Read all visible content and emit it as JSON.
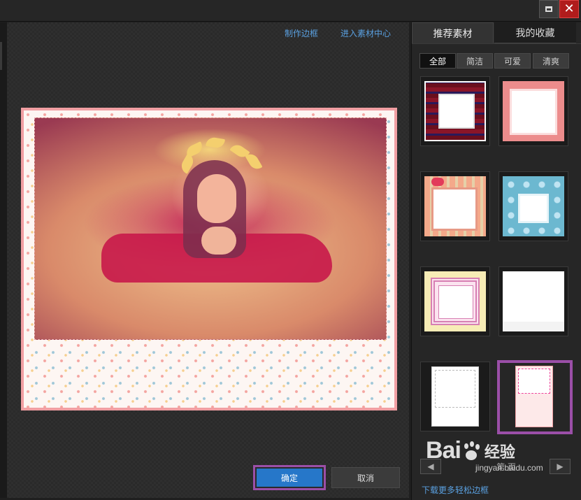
{
  "window": {
    "maximize_icon": "maximize-icon",
    "close_glyph": "✕"
  },
  "editor": {
    "link_make_border": "制作边框",
    "link_material_center": "进入素材中心",
    "ok_label": "确定",
    "cancel_label": "取消"
  },
  "sidebar": {
    "tabs": [
      {
        "label": "推荐素材",
        "active": true
      },
      {
        "label": "我的收藏",
        "active": false
      }
    ],
    "filters": [
      {
        "label": "全部",
        "active": true
      },
      {
        "label": "简洁"
      },
      {
        "label": "可爱"
      },
      {
        "label": "清爽"
      }
    ],
    "thumbnails": [
      {
        "name": "red-plaid-frame"
      },
      {
        "name": "pink-simple-frame"
      },
      {
        "name": "orange-stripe-frame"
      },
      {
        "name": "blue-heart-frame"
      },
      {
        "name": "yellow-pink-frame"
      },
      {
        "name": "white-lace-frame"
      },
      {
        "name": "white-floral-frame"
      },
      {
        "name": "pink-flower-frame",
        "selected": true
      }
    ],
    "pager": {
      "prev": "◀",
      "label": "第 页",
      "next": "▶"
    },
    "download_link": "下载更多轻松边框"
  },
  "watermark": {
    "brand_left": "Bai",
    "brand_right": "经验",
    "url": "jingyan.baidu.com"
  },
  "colors": {
    "accent": "#2677c9",
    "selection": "#9b4fa8",
    "frame_border": "#f19fa3",
    "link": "#5aa0e0"
  }
}
